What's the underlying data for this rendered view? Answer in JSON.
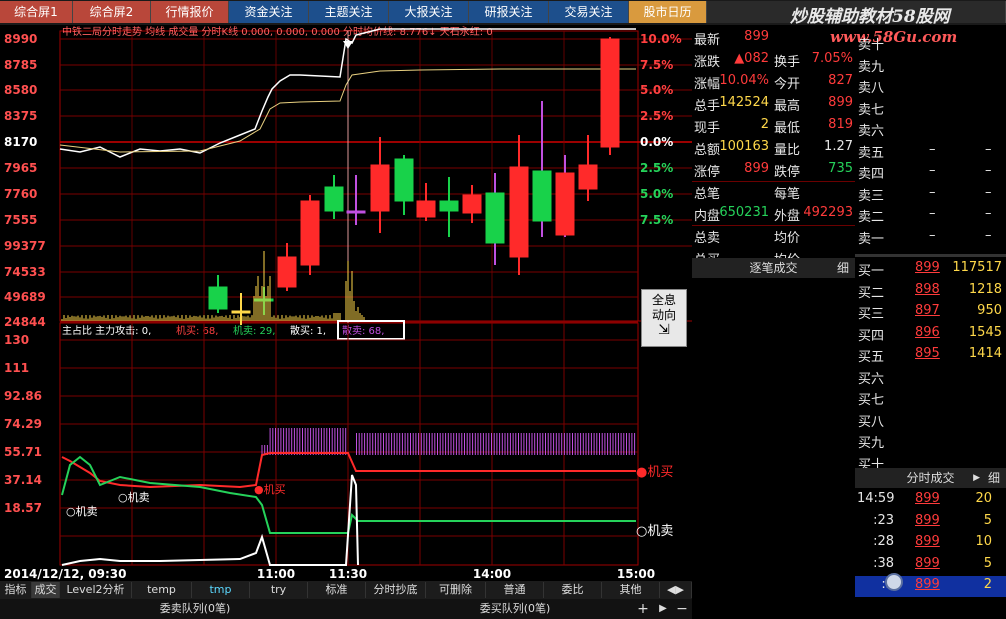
{
  "tabs": [
    {
      "label": "综合屏1",
      "style": "red"
    },
    {
      "label": "综合屏2",
      "style": "red"
    },
    {
      "label": "行情报价",
      "style": "red"
    },
    {
      "label": "资金关注",
      "style": "blue"
    },
    {
      "label": "主题关注",
      "style": "blue"
    },
    {
      "label": "大报关注",
      "style": "blue"
    },
    {
      "label": "研报关注",
      "style": "blue"
    },
    {
      "label": "交易关注",
      "style": "blue"
    },
    {
      "label": "股市日历",
      "style": "orange"
    }
  ],
  "watermark": {
    "text": "炒股辅助教材58股网",
    "url": "www.58Gu.com"
  },
  "chart": {
    "top_legend": "中铁二局分时走势 均线 成交量 分时K线 0.000, 0.000, 0.000 分时均价线: 8.776↓ 天石永红: 0",
    "price_axis": [
      "8990",
      "8785",
      "8580",
      "8375",
      "8170",
      "7965",
      "7760",
      "7555"
    ],
    "volume_axis": [
      "99377",
      "74533",
      "49689",
      "24844"
    ],
    "pct_axis": [
      "10.0%",
      "7.5%",
      "5.0%",
      "2.5%",
      "0.0%",
      "2.5%",
      "5.0%",
      "7.5%"
    ],
    "sub_legend": {
      "prefix": "主占比 主力攻击: 0,",
      "a": "机买: 68,",
      "b": "机卖: 29,",
      "c": "散买: 1,",
      "d": "散卖: 68,"
    },
    "sub_axis": [
      "130",
      "111",
      "92.86",
      "74.29",
      "55.71",
      "37.14",
      "18.57"
    ],
    "sub_labels": {
      "jimai_circle": "○机卖",
      "jimai2": "○机卖",
      "jibuy": "●机买",
      "jibuy_right": "●机买",
      "jisell_right": "○机卖"
    },
    "time_axis": [
      "2014/12/12, 09:30",
      "11:00",
      "11:30",
      "14:00",
      "15:00"
    ]
  },
  "full_button": {
    "line1": "全息",
    "line2": "动向"
  },
  "quote": {
    "rows": [
      {
        "l1": "最新",
        "v1": "899",
        "l2": "",
        "v2": ""
      },
      {
        "l1": "涨跌",
        "v1": "▲082",
        "l2": "换手",
        "v2": "7.05%"
      },
      {
        "l1": "涨幅",
        "v1": "10.04%",
        "l2": "今开",
        "v2": "827"
      },
      {
        "l1": "总手",
        "v1": "142524",
        "l2": "最高",
        "v2": "899"
      },
      {
        "l1": "现手",
        "v1": "2",
        "l2": "最低",
        "v2": "819"
      },
      {
        "l1": "总额",
        "v1": "100163",
        "l2": "量比",
        "v2": "1.27"
      },
      {
        "l1": "涨停",
        "v1": "899",
        "l2": "跌停",
        "v2": "735"
      },
      {
        "l1": "总笔",
        "v1": "",
        "l2": "每笔",
        "v2": ""
      },
      {
        "l1": "内盘",
        "v1": "650231",
        "l2": "外盘",
        "v2": "492293"
      },
      {
        "l1": "总卖",
        "v1": "",
        "l2": "均价",
        "v2": ""
      },
      {
        "l1": "总买",
        "v1": "",
        "l2": "均价",
        "v2": ""
      }
    ],
    "trade_head": "逐笔成交",
    "trade_side": "细"
  },
  "book": {
    "sells": [
      {
        "label": "卖十",
        "p": "",
        "v": ""
      },
      {
        "label": "卖九",
        "p": "",
        "v": ""
      },
      {
        "label": "卖八",
        "p": "",
        "v": ""
      },
      {
        "label": "卖七",
        "p": "",
        "v": ""
      },
      {
        "label": "卖六",
        "p": "",
        "v": ""
      },
      {
        "label": "卖五",
        "p": "–",
        "v": "–"
      },
      {
        "label": "卖四",
        "p": "–",
        "v": "–"
      },
      {
        "label": "卖三",
        "p": "–",
        "v": "–"
      },
      {
        "label": "卖二",
        "p": "–",
        "v": "–"
      },
      {
        "label": "卖一",
        "p": "–",
        "v": "–"
      }
    ],
    "buys": [
      {
        "label": "买一",
        "p": "899",
        "v": "117517"
      },
      {
        "label": "买二",
        "p": "898",
        "v": "1218"
      },
      {
        "label": "买三",
        "p": "897",
        "v": "950"
      },
      {
        "label": "买四",
        "p": "896",
        "v": "1545"
      },
      {
        "label": "买五",
        "p": "895",
        "v": "1414"
      },
      {
        "label": "买六",
        "p": "",
        "v": ""
      },
      {
        "label": "买七",
        "p": "",
        "v": ""
      },
      {
        "label": "买八",
        "p": "",
        "v": ""
      },
      {
        "label": "买九",
        "p": "",
        "v": ""
      },
      {
        "label": "买十",
        "p": "",
        "v": ""
      }
    ]
  },
  "ticks": {
    "head": "分时成交",
    "side": "细",
    "rows": [
      {
        "t": "14:59",
        "p": "899",
        "v": "20"
      },
      {
        "t": ":23",
        "p": "899",
        "v": "5"
      },
      {
        "t": ":28",
        "p": "899",
        "v": "10"
      },
      {
        "t": ":38",
        "p": "899",
        "v": "5"
      },
      {
        "t": ":5",
        "p": "899",
        "v": "2"
      }
    ]
  },
  "bottom_tabs": [
    "指标",
    "成交",
    "Level2分析",
    "temp",
    "tmp",
    "try",
    "标准",
    "分时抄底",
    "可删除",
    "普通",
    "委比",
    "其他"
  ],
  "queue_tabs": [
    "委卖队列(0笔)",
    "委买队列(0笔)"
  ],
  "colors": {
    "grid": "#7a0000",
    "price_line": "#ffffff",
    "avg_line": "#e8d080",
    "up": "#ff2a2a",
    "down": "#18d24a",
    "purple": "#c050e0"
  }
}
